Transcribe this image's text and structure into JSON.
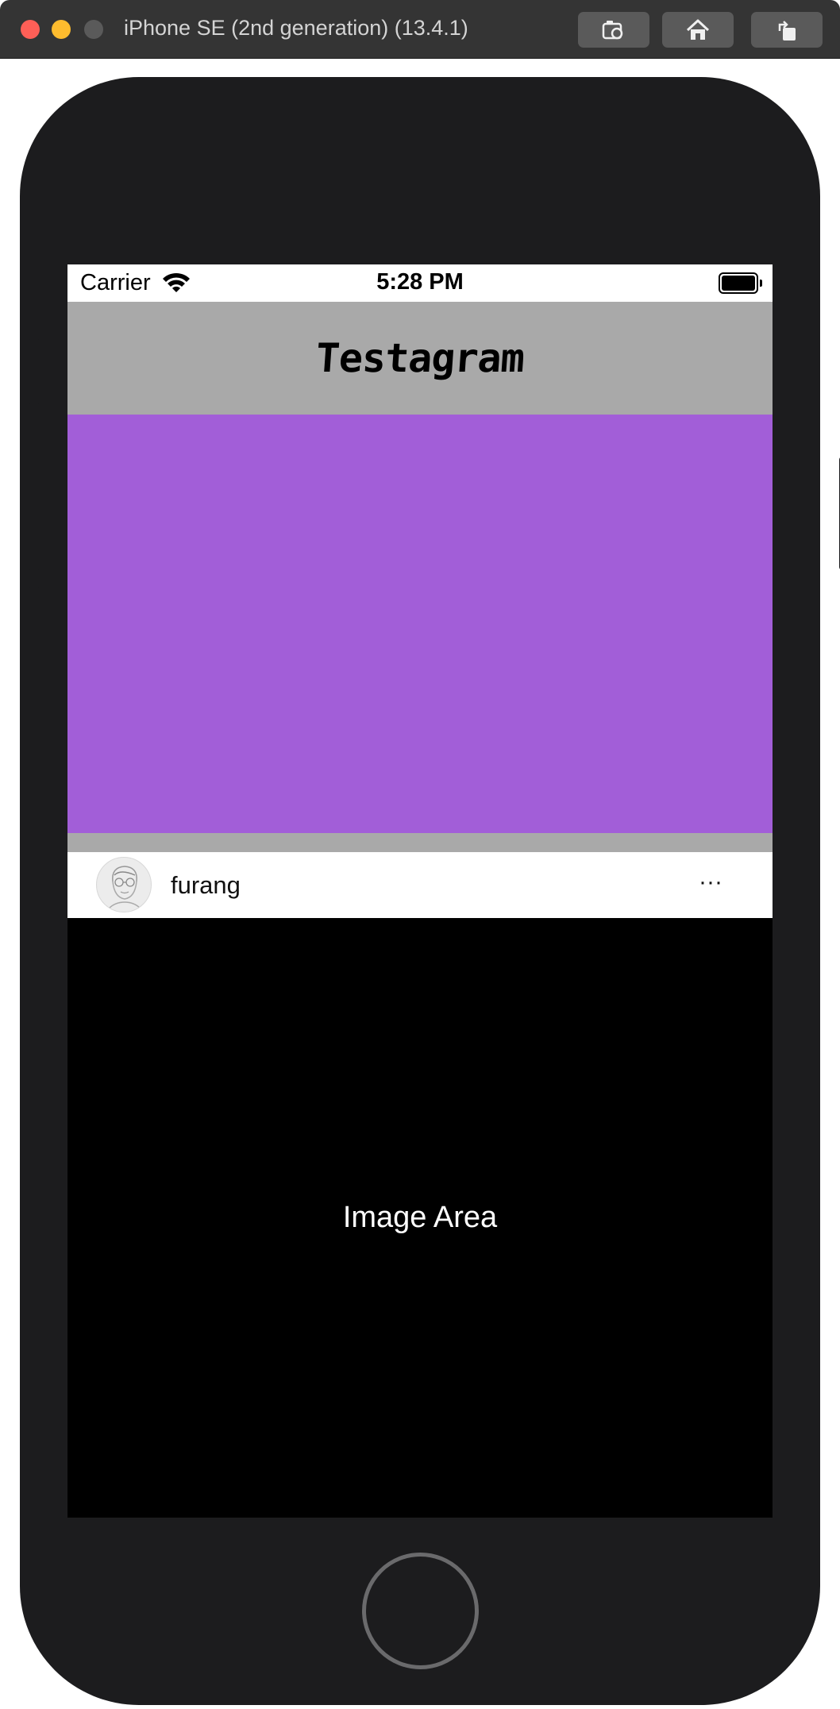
{
  "window": {
    "title": "iPhone SE (2nd generation) (13.4.1)",
    "toolbar": [
      {
        "name": "screenshot",
        "icon": "camera-icon"
      },
      {
        "name": "home",
        "icon": "home-icon"
      },
      {
        "name": "rotate",
        "icon": "rotate-icon"
      }
    ]
  },
  "status_bar": {
    "carrier": "Carrier",
    "time": "5:28 PM",
    "wifi_icon": "wifi-icon",
    "battery_icon": "battery-icon",
    "battery_level": 1.0
  },
  "nav": {
    "title": "Testagram"
  },
  "colors": {
    "nav_background": "#a9a9a9",
    "story_area": "#a25ed8",
    "image_area": "#000000"
  },
  "post": {
    "username": "furang",
    "more_label": "···",
    "image_label": "Image Area"
  }
}
